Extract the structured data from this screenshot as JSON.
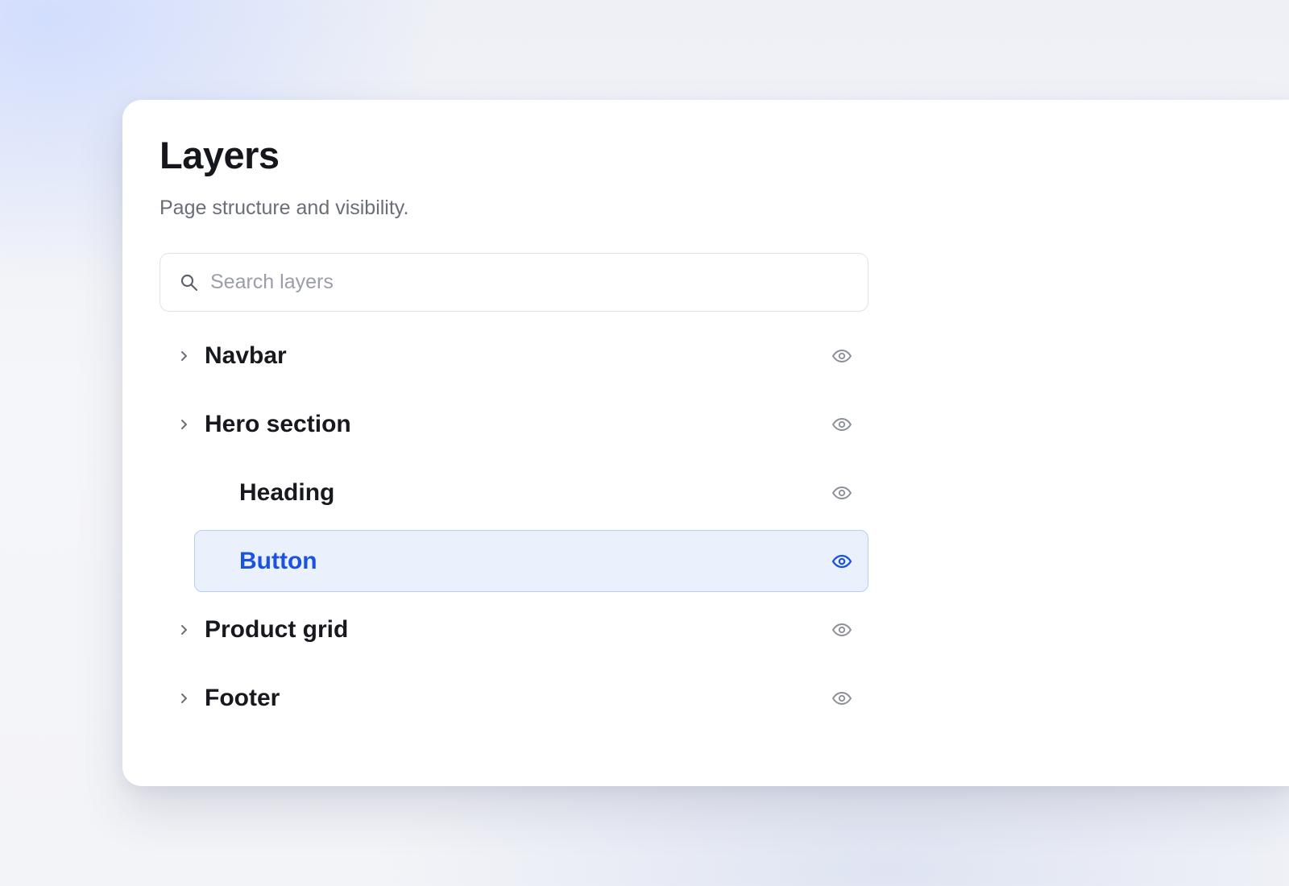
{
  "panel": {
    "title": "Layers",
    "subtitle": "Page structure and visibility."
  },
  "search": {
    "placeholder": "Search layers",
    "value": "",
    "icon": "search-icon"
  },
  "layers": [
    {
      "label": "Navbar",
      "level": 0,
      "expandable": true,
      "visible": true,
      "selected": false
    },
    {
      "label": "Hero section",
      "level": 0,
      "expandable": true,
      "visible": true,
      "selected": false
    },
    {
      "label": "Heading",
      "level": 1,
      "expandable": false,
      "visible": true,
      "selected": false
    },
    {
      "label": "Button",
      "level": 1,
      "expandable": false,
      "visible": true,
      "selected": true
    },
    {
      "label": "Product grid",
      "level": 0,
      "expandable": true,
      "visible": true,
      "selected": false
    },
    {
      "label": "Footer",
      "level": 0,
      "expandable": true,
      "visible": true,
      "selected": false
    }
  ],
  "icons": {
    "expand": "chevron-right-icon",
    "visibility": "eye-icon"
  },
  "colors": {
    "accent": "#1a53e0",
    "selected_bg": "#eaf1fd",
    "selected_border": "#b9cdf3",
    "icon_muted": "#8c9099"
  }
}
